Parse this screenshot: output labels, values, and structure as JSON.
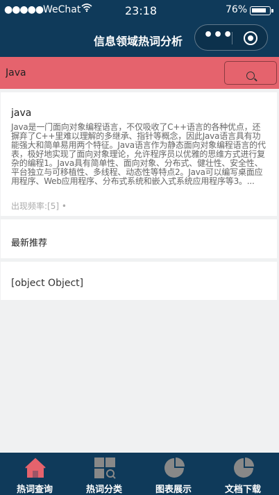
{
  "status": {
    "signal": "●●●●●",
    "carrier": "WeChat",
    "time": "23:18",
    "battery": "76%"
  },
  "nav": {
    "title": "信息领域热词分析",
    "more": "•••"
  },
  "search": {
    "value": "Java"
  },
  "result": {
    "title": "java",
    "description": "Java是一门面向对象编程语言，不仅吸收了C++语言的各种优点，还摒弃了C++里难以理解的多继承、指针等概念，因此Java语言具有功能强大和简单易用两个特征。Java语言作为静态面向对象编程语言的代表，极好地实现了面向对象理论，允许程序员以优雅的思维方式进行复杂的编程1。Java具有简单性、面向对象、分布式、健壮性、安全性、平台独立与可移植性、多线程、动态性等特点2。Java可以编写桌面应用程序、Web应用程序、分布式系统和嵌入式系统应用程序等3。...",
    "frequency": "出现频率:[5] •"
  },
  "recommend": {
    "title": "最新推荐"
  },
  "object_item": {
    "text": "[object Object]"
  },
  "tabs": [
    {
      "label": "热词查询",
      "icon": "home-icon"
    },
    {
      "label": "热词分类",
      "icon": "grid-icon"
    },
    {
      "label": "图表展示",
      "icon": "pie-chart-icon"
    },
    {
      "label": "文档下载",
      "icon": "pie-chart-icon"
    }
  ],
  "colors": {
    "header": "#0f3a5a",
    "search_bar": "#e5636d",
    "active_tab_icon": "#e5636d",
    "inactive_tab_icon": "#888888"
  }
}
